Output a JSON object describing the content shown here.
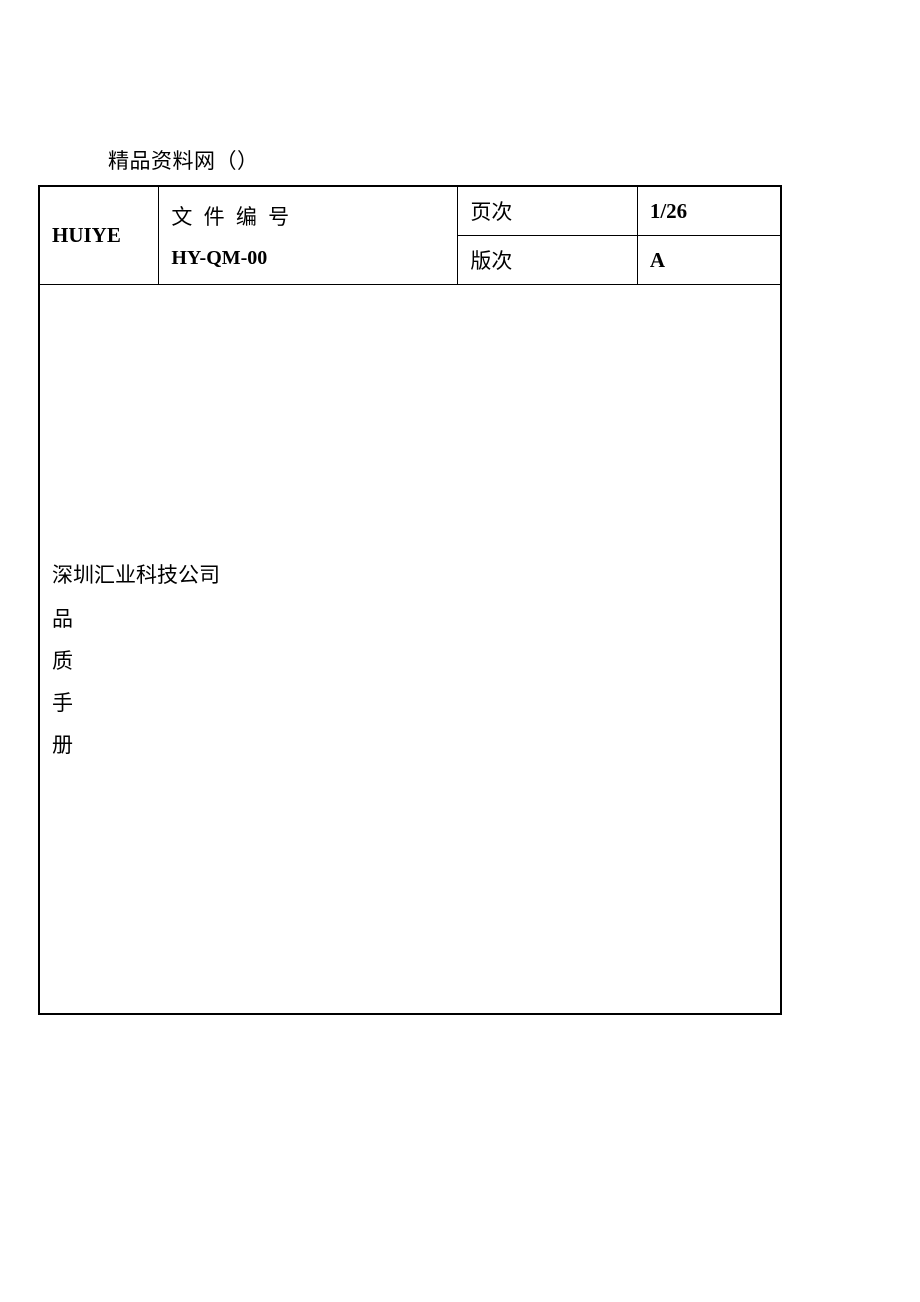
{
  "site_note": "精品资料网（）",
  "brand": "HUIYE",
  "doc_no_label": "文  件  编  号",
  "doc_no_value": "HY-QM-00",
  "page_label": "页次",
  "page_value": "1/26",
  "version_label": "版次",
  "version_value": "A",
  "company": "深圳汇业科技公司",
  "title_chars": [
    "品",
    "质",
    "手",
    "册"
  ]
}
